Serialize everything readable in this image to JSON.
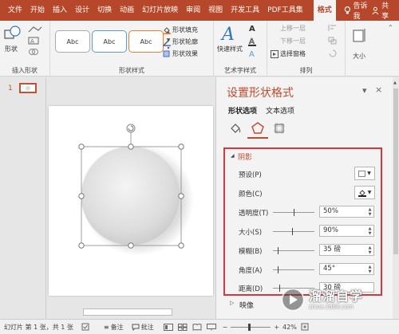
{
  "menu": {
    "tabs": [
      "文件",
      "开始",
      "插入",
      "设计",
      "切换",
      "动画",
      "幻灯片放映",
      "审阅",
      "视图",
      "开发工具",
      "PDF工具集"
    ],
    "active_tab": "格式",
    "tell_me": "告诉我",
    "share": "共享"
  },
  "ribbon": {
    "insert_shapes": {
      "label": "插入形状",
      "shape_btn": "形状"
    },
    "shape_styles": {
      "label": "形状样式",
      "samples": [
        "Abc",
        "Abc",
        "Abc"
      ],
      "fill": "形状填充",
      "outline": "形状轮廓",
      "effects": "形状效果"
    },
    "wordart": {
      "label": "艺术字样式",
      "quick": "快速样式",
      "a": "A"
    },
    "arrange": {
      "label": "排列",
      "bring_forward": "上移一层",
      "send_backward": "下移一层",
      "selection_pane": "选择窗格"
    },
    "size": {
      "label": "大小"
    }
  },
  "thumbs": {
    "number": "1"
  },
  "pane": {
    "title": "设置形状格式",
    "tabs": [
      "形状选项",
      "文本选项"
    ],
    "shadow_section": "阴影",
    "rows": {
      "preset": "预设(P)",
      "color": "颜色(C)",
      "transparency": "透明度(T)",
      "size": "大小(S)",
      "blur": "模糊(B)",
      "angle": "角度(A)",
      "distance": "距离(D)"
    },
    "values": {
      "transparency": "50%",
      "size": "90%",
      "blur": "35 磅",
      "angle": "45°",
      "distance": "30 磅"
    },
    "reflection": "映像"
  },
  "status": {
    "slide_info": "幻灯片 第 1 张，共 1 张",
    "notes": "备注",
    "comments": "批注",
    "zoom": "42%"
  },
  "watermark": {
    "line1": "溜溜自学",
    "line2": "zixue.3d66.com"
  },
  "colors": {
    "accent": "#b7472a",
    "highlight": "#d2383d",
    "pane_title": "#c14a2e"
  }
}
